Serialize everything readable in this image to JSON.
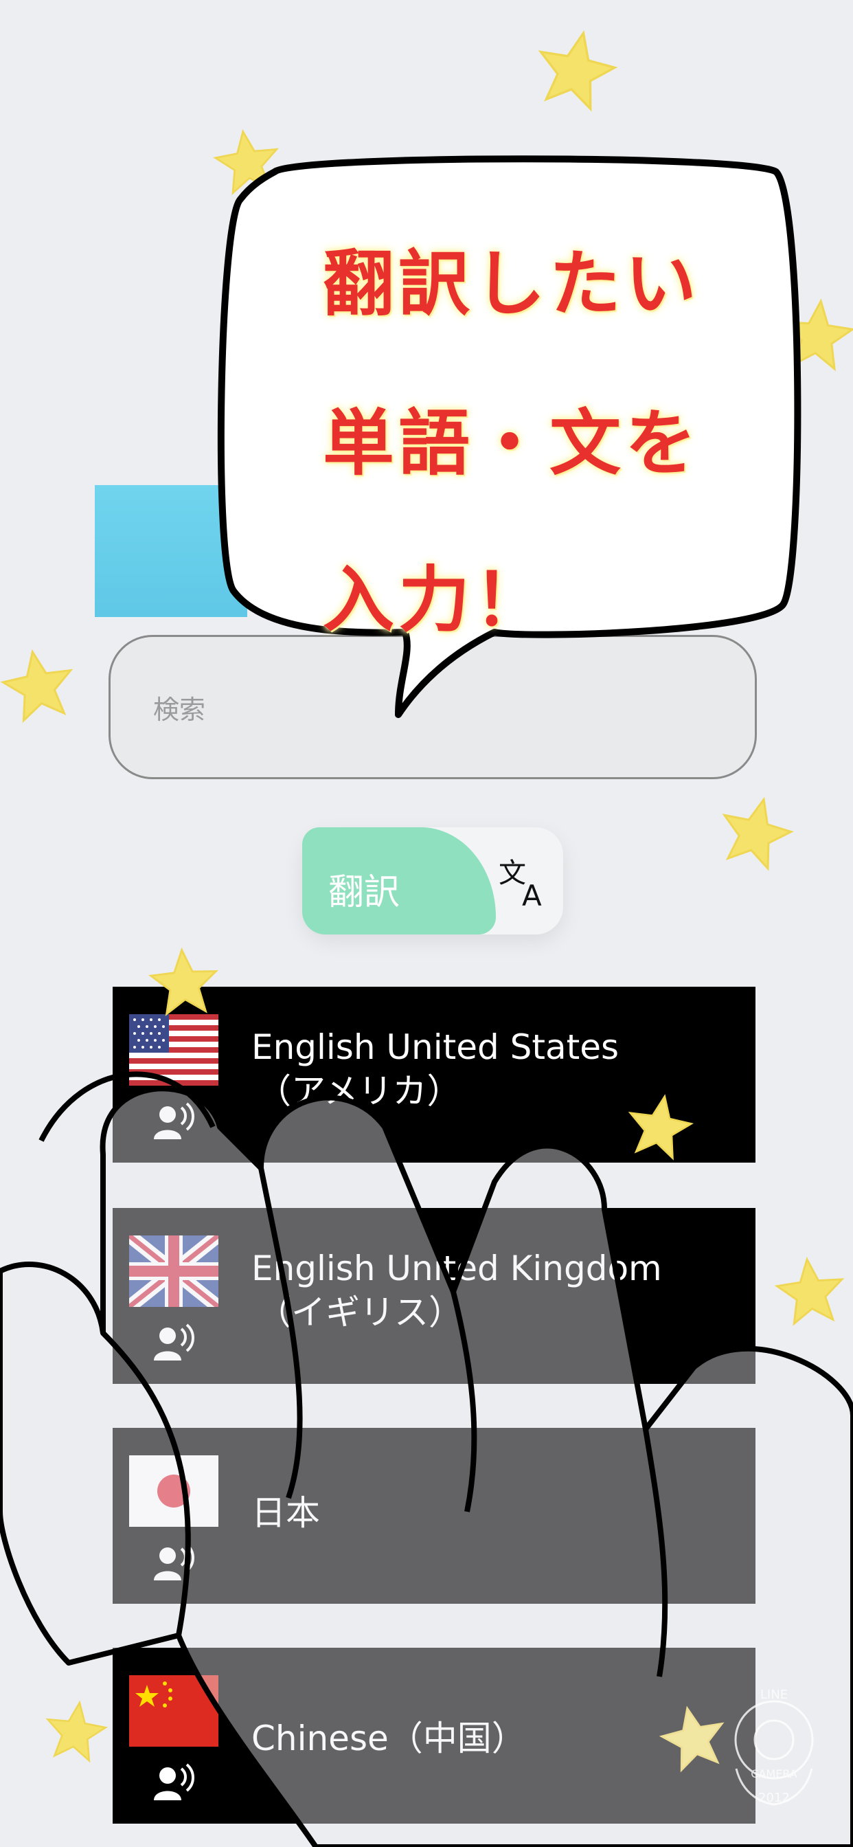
{
  "search": {
    "placeholder": "検索"
  },
  "translate": {
    "label": "翻訳",
    "icon": "translate-icon"
  },
  "languages": [
    {
      "name": "English United States",
      "sub": "（アメリカ）",
      "flag": "us-flag-icon",
      "speak_icon": "speaker-icon"
    },
    {
      "name": "English United Kingdom",
      "sub": "（イギリス）",
      "flag": "uk-flag-icon",
      "speak_icon": "speaker-icon"
    },
    {
      "name": "日本",
      "sub": "",
      "flag": "japan-flag-icon",
      "speak_icon": "speaker-icon"
    },
    {
      "name": "Chinese（中国）",
      "sub": "",
      "flag": "china-flag-icon",
      "speak_icon": "speaker-icon"
    }
  ],
  "callout": {
    "line1": "翻訳したい",
    "line2": "単語・文を",
    "line3": "入力！"
  },
  "watermark": {
    "top": "LINE",
    "bottom": "CAMERA",
    "year": "2012"
  },
  "colors": {
    "accent_green": "#8fe0bf",
    "header_blue": "#6cd0ea",
    "callout_red": "#e8312d",
    "star_yellow": "#f4e26a",
    "row_black": "#000000"
  }
}
